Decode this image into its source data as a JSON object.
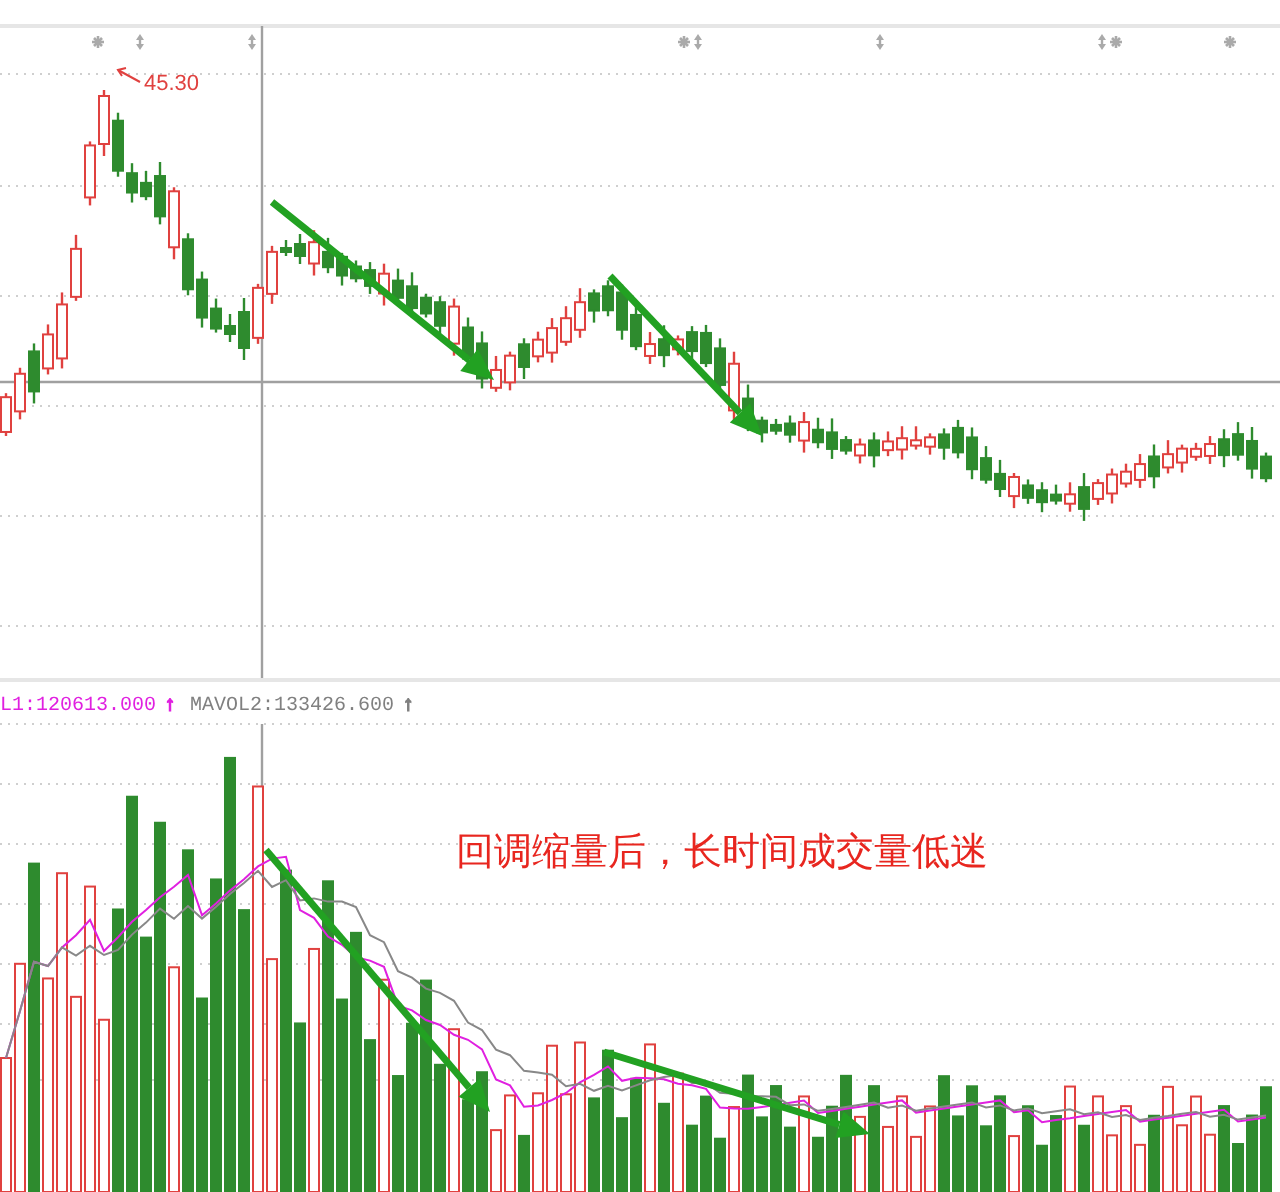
{
  "price_panel": {
    "high_label": "45.30"
  },
  "volume_panel": {
    "legend": [
      {
        "text": "L1:120613.000",
        "color": "#e020e0"
      },
      {
        "text": "↑",
        "color": "#e020e0"
      },
      {
        "text": "MAVOL2:133426.600",
        "color": "#808080"
      },
      {
        "text": "↑",
        "color": "#808080"
      }
    ],
    "annotation": "回调缩量后，长时间成交量低迷"
  }
}
